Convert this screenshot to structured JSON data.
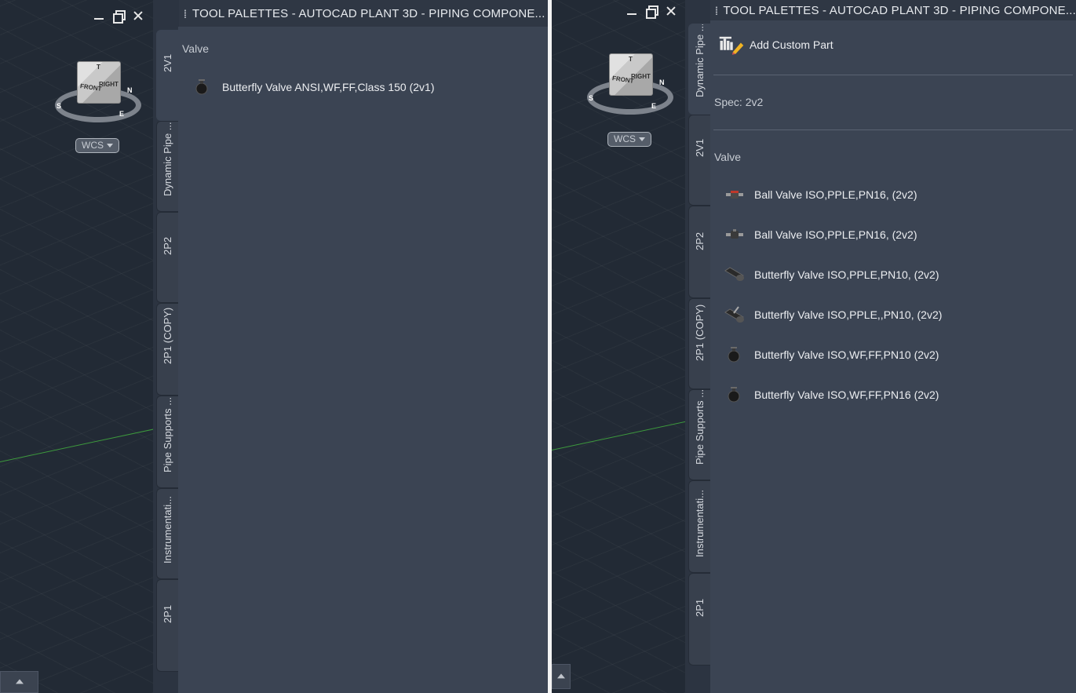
{
  "left_window": {
    "palette_title": "TOOL PALETTES - AUTOCAD PLANT 3D - PIPING COMPONE...",
    "viewcube": {
      "top_label": "T",
      "front_label": "FRONT",
      "right_label": "RIGHT",
      "compass": [
        "S",
        "E",
        "N"
      ]
    },
    "wcs_label": "WCS",
    "tabs": [
      {
        "label": "2V1",
        "active": true
      },
      {
        "label": "Dynamic Pipe ...",
        "active": false
      },
      {
        "label": "2P2",
        "active": false
      },
      {
        "label": "2P1 (COPY)",
        "active": false
      },
      {
        "label": "Pipe Supports ...",
        "active": false
      },
      {
        "label": "Instrumentati...",
        "active": false
      },
      {
        "label": "2P1",
        "active": false
      }
    ],
    "section_label": "Valve",
    "items": [
      {
        "label": "Butterfly Valve ANSI,WF,FF,Class 150 (2v1)",
        "icon": "butterfly-valve-wafer-icon"
      }
    ]
  },
  "right_window": {
    "palette_title": "TOOL PALETTES - AUTOCAD PLANT 3D - PIPING COMPONE...",
    "viewcube": {
      "top_label": "T",
      "front_label": "FRONT",
      "right_label": "RIGHT",
      "compass": [
        "S",
        "E",
        "N"
      ]
    },
    "wcs_label": "WCS",
    "tabs": [
      {
        "label": "Dynamic Pipe ...",
        "active": true
      },
      {
        "label": "2V1",
        "active": false
      },
      {
        "label": "2P2",
        "active": false
      },
      {
        "label": "2P1 (COPY)",
        "active": false
      },
      {
        "label": "Pipe Supports ...",
        "active": false
      },
      {
        "label": "Instrumentati...",
        "active": false
      },
      {
        "label": "2P1",
        "active": false
      }
    ],
    "add_custom_part": "Add Custom Part",
    "spec_label": "Spec: 2v2",
    "section_label": "Valve",
    "items": [
      {
        "label": "Ball Valve ISO,PPLE,PN16, (2v2)",
        "icon": "ball-valve-red-icon"
      },
      {
        "label": "Ball Valve ISO,PPLE,PN16, (2v2)",
        "icon": "ball-valve-icon"
      },
      {
        "label": "Butterfly Valve ISO,PPLE,PN10, (2v2)",
        "icon": "butterfly-valve-lug-icon"
      },
      {
        "label": "Butterfly Valve ISO,PPLE,,PN10, (2v2)",
        "icon": "butterfly-valve-lever-icon"
      },
      {
        "label": "Butterfly Valve ISO,WF,FF,PN10 (2v2)",
        "icon": "butterfly-valve-wafer-icon"
      },
      {
        "label": "Butterfly Valve ISO,WF,FF,PN16 (2v2)",
        "icon": "butterfly-valve-wafer-icon"
      }
    ]
  },
  "colors": {
    "palette_bg": "#3b4453",
    "viewport_bg": "#222a35",
    "grid_axis_green": "#3d9a3d",
    "text": "#eceef1"
  }
}
